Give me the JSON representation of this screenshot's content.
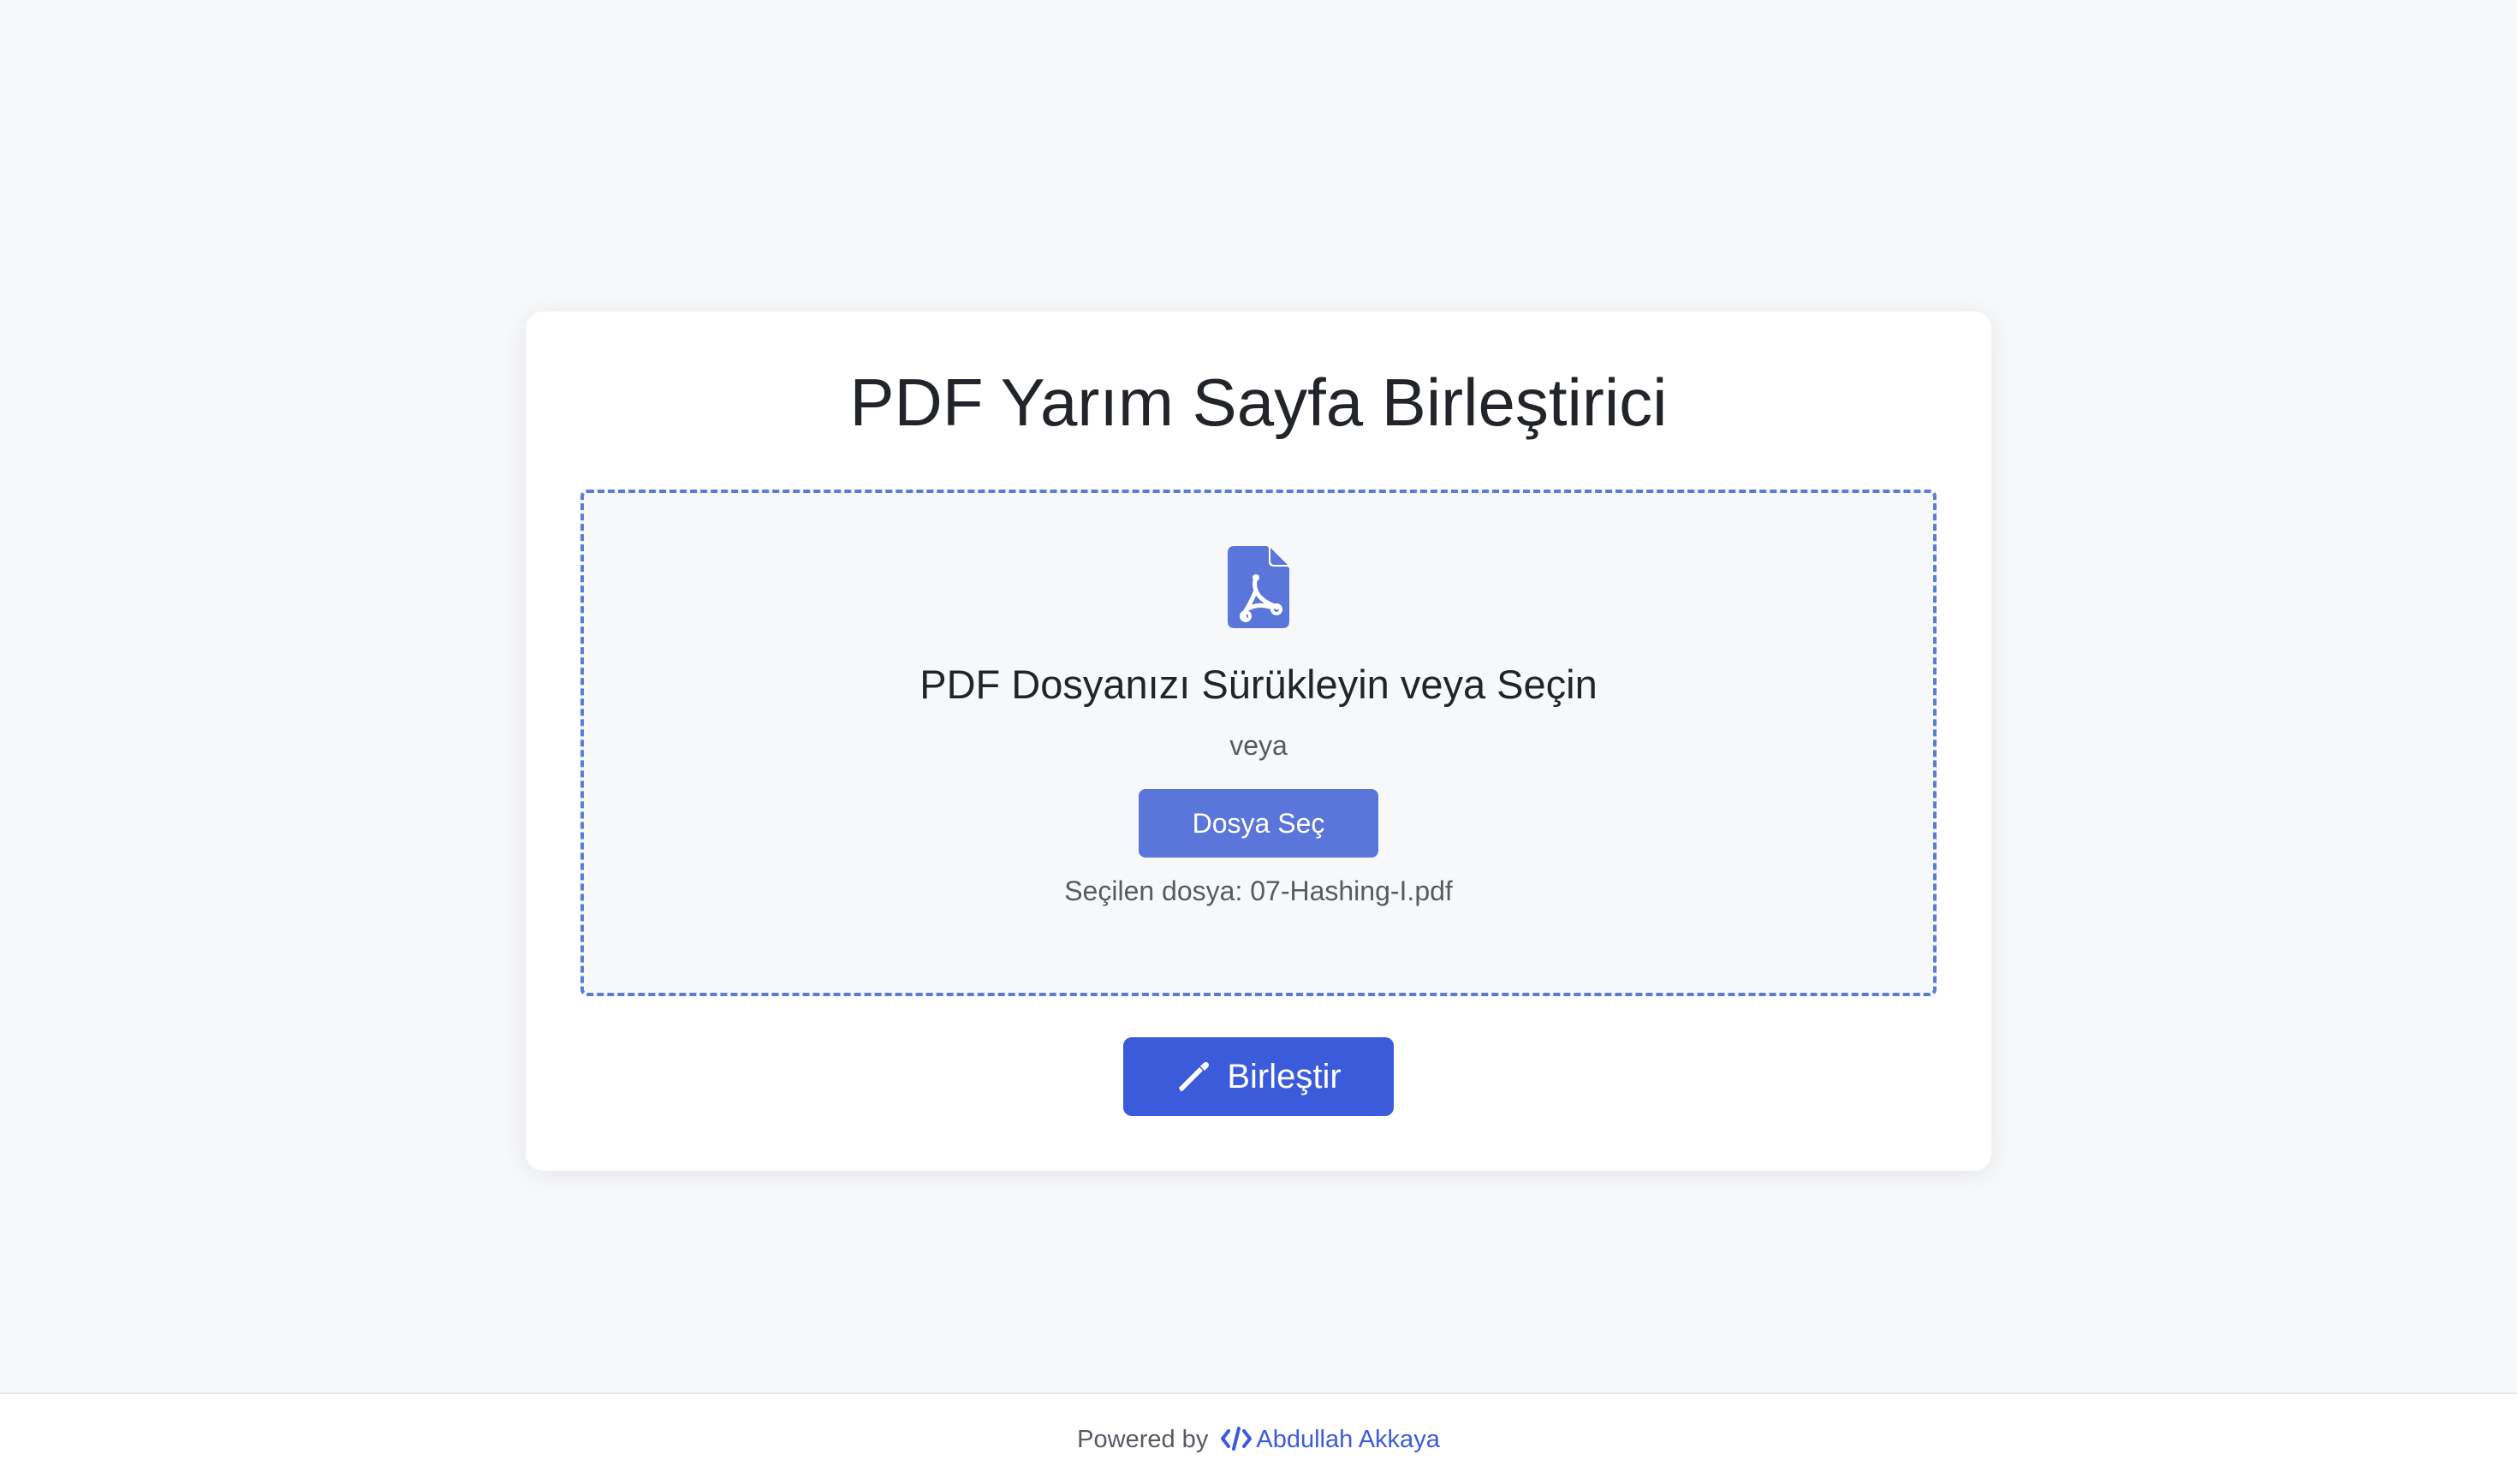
{
  "header": {
    "title": "PDF Yarım Sayfa Birleştirici"
  },
  "dropzone": {
    "icon": "file-pdf-icon",
    "title": "PDF Dosyanızı Sürükleyin veya Seçin",
    "or_text": "veya",
    "choose_label": "Dosya Seç",
    "selected_file_text": "Seçilen dosya: 07-Hashing-I.pdf"
  },
  "actions": {
    "merge_icon": "magic-wand-icon",
    "merge_label": "Birleştir"
  },
  "footer": {
    "powered_by": "Powered by",
    "author_icon": "code-icon",
    "author": "Abdullah Akkaya"
  },
  "colors": {
    "background": "#f7f8fa",
    "card": "#ffffff",
    "accent": "#3b5bdb",
    "choose_button": "#5b76da",
    "dropzone_border": "#5b7bd5"
  }
}
